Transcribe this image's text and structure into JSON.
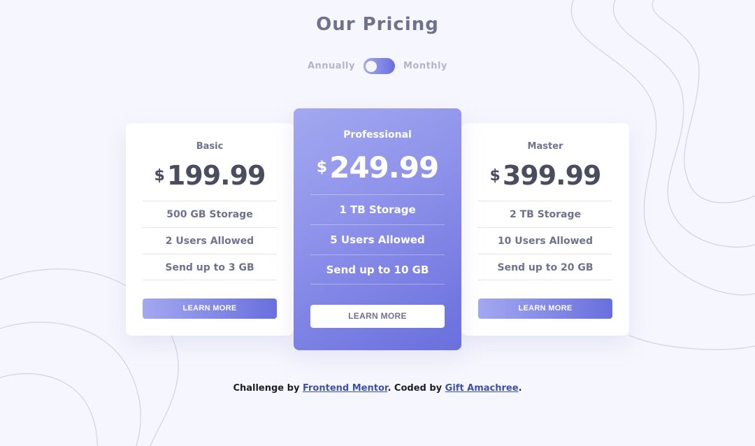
{
  "title": "Our Pricing",
  "toggle": {
    "left_label": "Annually",
    "right_label": "Monthly"
  },
  "plans": [
    {
      "name": "Basic",
      "currency": "$",
      "price": "199.99",
      "features": [
        "500 GB Storage",
        "2 Users Allowed",
        "Send up to 3 GB"
      ],
      "button": "LEARN MORE"
    },
    {
      "name": "Professional",
      "currency": "$",
      "price": "249.99",
      "features": [
        "1 TB Storage",
        "5 Users Allowed",
        "Send up to 10 GB"
      ],
      "button": "LEARN MORE"
    },
    {
      "name": "Master",
      "currency": "$",
      "price": "399.99",
      "features": [
        "2 TB Storage",
        "10 Users Allowed",
        "Send up to 20 GB"
      ],
      "button": "LEARN MORE"
    }
  ],
  "footer": {
    "prefix": "Challenge by ",
    "link1": "Frontend Mentor",
    "middle": ". Coded by ",
    "link2": "Gift Amachree",
    "suffix": "."
  },
  "colors": {
    "accent_light": "#a3a8f0",
    "accent_dark": "#696fdd",
    "background": "#f6f6fe"
  }
}
